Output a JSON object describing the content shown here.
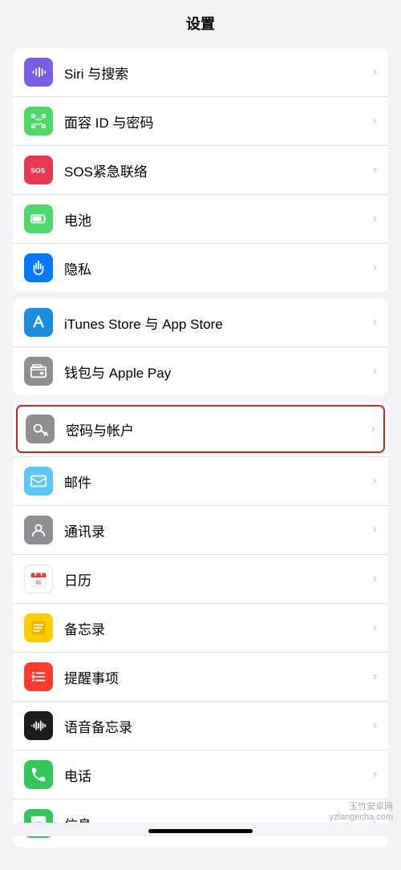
{
  "page": {
    "title": "设置"
  },
  "groups": [
    {
      "id": "group1",
      "items": [
        {
          "id": "siri",
          "label": "Siri 与搜索",
          "icon": "siri",
          "bg": "purple"
        },
        {
          "id": "faceid",
          "label": "面容 ID 与密码",
          "icon": "faceid",
          "bg": "green2"
        },
        {
          "id": "sos",
          "label": "SOS紧急联络",
          "icon": "sos",
          "bg": "red"
        },
        {
          "id": "battery",
          "label": "电池",
          "icon": "battery",
          "bg": "green"
        },
        {
          "id": "privacy",
          "label": "隐私",
          "icon": "privacy",
          "bg": "blue"
        }
      ]
    },
    {
      "id": "group2",
      "items": [
        {
          "id": "itunes",
          "label": "iTunes Store 与 App Store",
          "icon": "appstore",
          "bg": "blue2"
        },
        {
          "id": "wallet",
          "label": "钱包与 Apple Pay",
          "icon": "wallet",
          "bg": "gray"
        }
      ]
    },
    {
      "id": "group3",
      "items": [
        {
          "id": "passwords",
          "label": "密码与帐户",
          "icon": "key",
          "bg": "gray2",
          "highlighted": true
        },
        {
          "id": "mail",
          "label": "邮件",
          "icon": "mail",
          "bg": "blue3"
        },
        {
          "id": "contacts",
          "label": "通讯录",
          "icon": "contacts",
          "bg": "gray3"
        },
        {
          "id": "calendar",
          "label": "日历",
          "icon": "calendar",
          "bg": "red2"
        },
        {
          "id": "notes",
          "label": "备忘录",
          "icon": "notes",
          "bg": "yellow"
        },
        {
          "id": "reminders",
          "label": "提醒事项",
          "icon": "reminders",
          "bg": "red3"
        },
        {
          "id": "voicememos",
          "label": "语音备忘录",
          "icon": "voicememos",
          "bg": "gray4"
        },
        {
          "id": "phone",
          "label": "电话",
          "icon": "phone",
          "bg": "green5"
        },
        {
          "id": "messages",
          "label": "信息",
          "icon": "messages",
          "bg": "green6"
        }
      ]
    }
  ],
  "watermark": {
    "line1": "玉竹安卓网",
    "line2": "yzlangecha.com"
  }
}
